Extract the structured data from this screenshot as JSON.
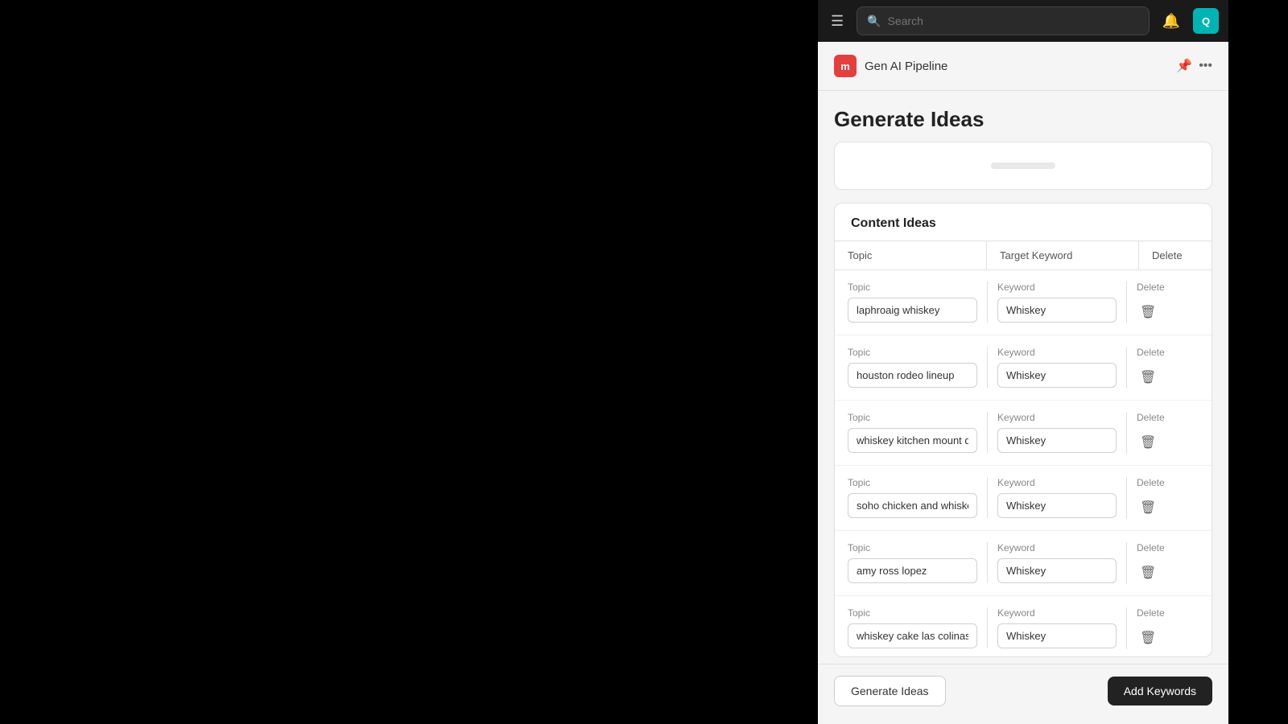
{
  "topbar": {
    "menu_icon": "☰",
    "search_placeholder": "Search",
    "bell_icon": "🔔",
    "avatar_text": "Q"
  },
  "panel": {
    "logo_text": "m",
    "app_name": "Gen AI Pipeline",
    "page_title": "Generate Ideas"
  },
  "content_ideas": {
    "section_title": "Content Ideas",
    "table_headers": {
      "topic": "Topic",
      "keyword": "Target Keyword",
      "delete": "Delete"
    },
    "rows": [
      {
        "topic_label": "Topic",
        "topic_value": "laphroaig whiskey",
        "keyword_label": "Keyword",
        "keyword_value": "Whiskey",
        "delete_label": "Delete"
      },
      {
        "topic_label": "Topic",
        "topic_value": "houston rodeo lineup",
        "keyword_label": "Keyword",
        "keyword_value": "Whiskey",
        "delete_label": "Delete"
      },
      {
        "topic_label": "Topic",
        "topic_value": "whiskey kitchen mount dora",
        "keyword_label": "Keyword",
        "keyword_value": "Whiskey",
        "delete_label": "Delete"
      },
      {
        "topic_label": "Topic",
        "topic_value": "soho chicken and whiskey",
        "keyword_label": "Keyword",
        "keyword_value": "Whiskey",
        "delete_label": "Delete"
      },
      {
        "topic_label": "Topic",
        "topic_value": "amy ross lopez",
        "keyword_label": "Keyword",
        "keyword_value": "Whiskey",
        "delete_label": "Delete"
      },
      {
        "topic_label": "Topic",
        "topic_value": "whiskey cake las colinas",
        "keyword_label": "Keyword",
        "keyword_value": "Whiskey",
        "delete_label": "Delete"
      }
    ]
  },
  "buttons": {
    "generate_ideas": "Generate Ideas",
    "add_keywords": "Add Keywords"
  }
}
